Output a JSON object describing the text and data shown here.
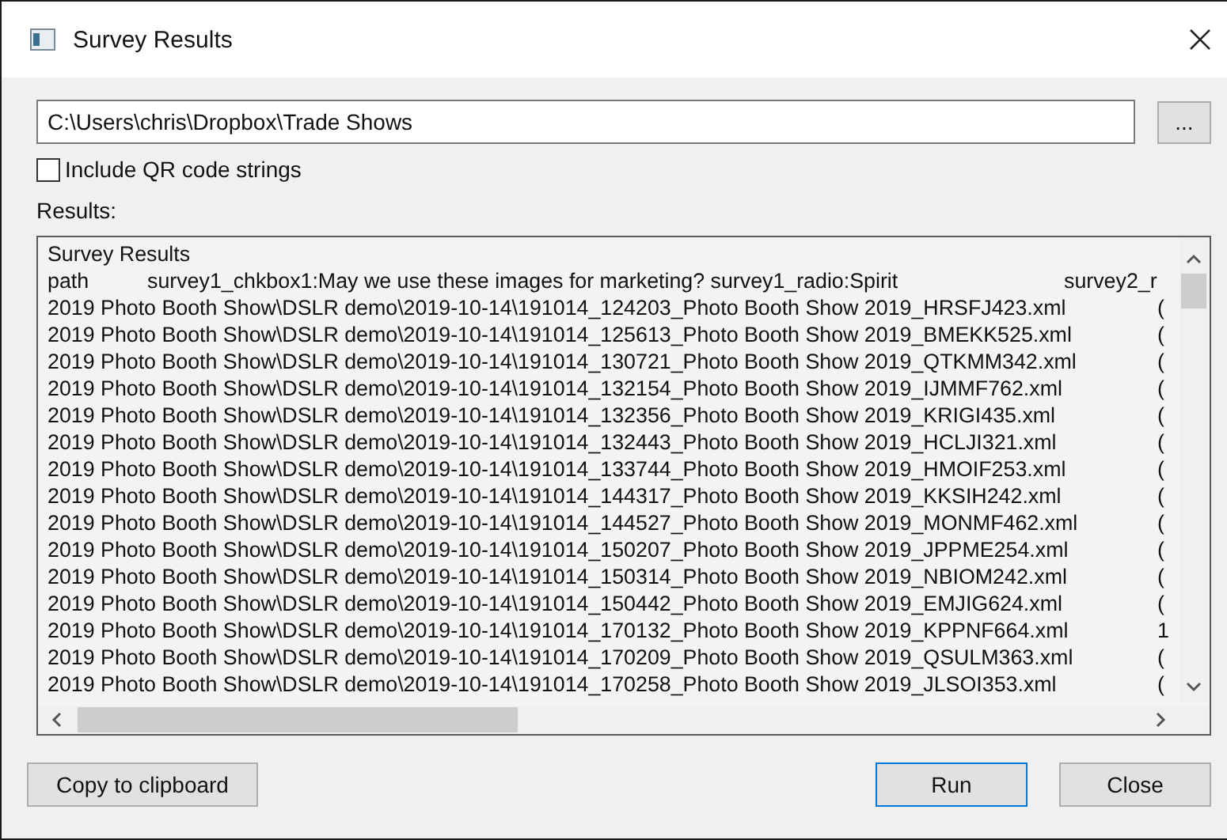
{
  "window": {
    "title": "Survey Results"
  },
  "folder": {
    "value": "C:\\Users\\chris\\Dropbox\\Trade Shows",
    "browse_label": "..."
  },
  "include_qr": {
    "label": "Include QR code strings",
    "checked": false
  },
  "results": {
    "label": "Results:",
    "heading": "Survey Results",
    "columns": [
      "path",
      "survey1_chkbox1:May we use these images for marketing? survey1_radio:Spirit",
      "survey2_r"
    ],
    "rows": [
      {
        "path": "2019 Photo Booth Show\\DSLR demo\\2019-10-14\\191014_124203_Photo Booth Show 2019_HRSFJ423.xml",
        "column_2": "("
      },
      {
        "path": "2019 Photo Booth Show\\DSLR demo\\2019-10-14\\191014_125613_Photo Booth Show 2019_BMEKK525.xml",
        "column_2": "("
      },
      {
        "path": "2019 Photo Booth Show\\DSLR demo\\2019-10-14\\191014_130721_Photo Booth Show 2019_QTKMM342.xml",
        "column_2": "("
      },
      {
        "path": "2019 Photo Booth Show\\DSLR demo\\2019-10-14\\191014_132154_Photo Booth Show 2019_IJMMF762.xml",
        "column_2": "("
      },
      {
        "path": "2019 Photo Booth Show\\DSLR demo\\2019-10-14\\191014_132356_Photo Booth Show 2019_KRIGI435.xml",
        "column_2": "("
      },
      {
        "path": "2019 Photo Booth Show\\DSLR demo\\2019-10-14\\191014_132443_Photo Booth Show 2019_HCLJI321.xml",
        "column_2": "("
      },
      {
        "path": "2019 Photo Booth Show\\DSLR demo\\2019-10-14\\191014_133744_Photo Booth Show 2019_HMOIF253.xml",
        "column_2": "("
      },
      {
        "path": "2019 Photo Booth Show\\DSLR demo\\2019-10-14\\191014_144317_Photo Booth Show 2019_KKSIH242.xml",
        "column_2": "("
      },
      {
        "path": "2019 Photo Booth Show\\DSLR demo\\2019-10-14\\191014_144527_Photo Booth Show 2019_MONMF462.xml",
        "column_2": "("
      },
      {
        "path": "2019 Photo Booth Show\\DSLR demo\\2019-10-14\\191014_150207_Photo Booth Show 2019_JPPME254.xml",
        "column_2": "("
      },
      {
        "path": "2019 Photo Booth Show\\DSLR demo\\2019-10-14\\191014_150314_Photo Booth Show 2019_NBIOM242.xml",
        "column_2": "("
      },
      {
        "path": "2019 Photo Booth Show\\DSLR demo\\2019-10-14\\191014_150442_Photo Booth Show 2019_EMJIG624.xml",
        "column_2": "("
      },
      {
        "path": "2019 Photo Booth Show\\DSLR demo\\2019-10-14\\191014_170132_Photo Booth Show 2019_KPPNF664.xml",
        "column_2": "1"
      },
      {
        "path": "2019 Photo Booth Show\\DSLR demo\\2019-10-14\\191014_170209_Photo Booth Show 2019_QSULM363.xml",
        "column_2": "("
      },
      {
        "path": "2019 Photo Booth Show\\DSLR demo\\2019-10-14\\191014_170258_Photo Booth Show 2019_JLSOI353.xml",
        "column_2": "("
      }
    ]
  },
  "buttons": {
    "copy": "Copy to clipboard",
    "run": "Run",
    "close": "Close"
  }
}
